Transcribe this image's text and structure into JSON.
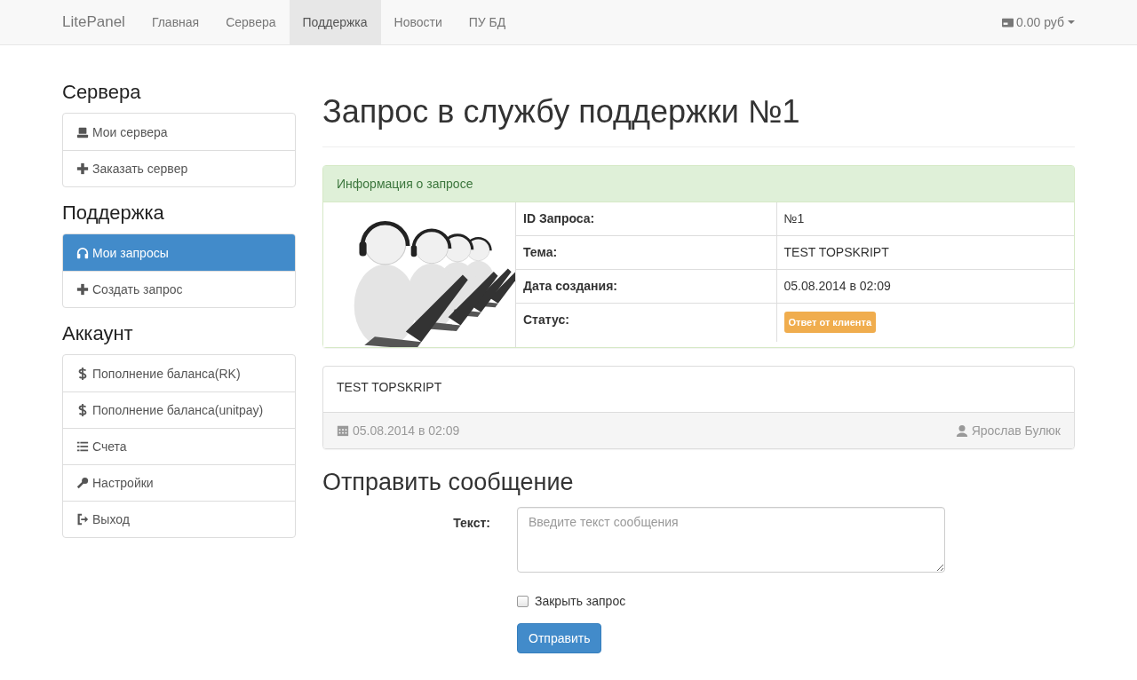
{
  "navbar": {
    "brand": "LitePanel",
    "items": [
      {
        "label": "Главная",
        "selected": false
      },
      {
        "label": "Сервера",
        "selected": false
      },
      {
        "label": "Поддержка",
        "selected": true
      },
      {
        "label": "Новости",
        "selected": false
      },
      {
        "label": "ПУ БД",
        "selected": false
      }
    ],
    "balance": "0.00 руб"
  },
  "sidebar": [
    {
      "heading": "Сервера",
      "items": [
        {
          "label": "Мои сервера",
          "kind": "server",
          "selected": false
        },
        {
          "label": "Заказать сервер",
          "kind": "plus",
          "selected": false
        }
      ]
    },
    {
      "heading": "Поддержка",
      "items": [
        {
          "label": "Мои запросы",
          "kind": "headphones",
          "selected": true
        },
        {
          "label": "Создать запрос",
          "kind": "plus",
          "selected": false
        }
      ]
    },
    {
      "heading": "Аккаунт",
      "items": [
        {
          "label": "Пополнение баланса(RK)",
          "kind": "dollar",
          "selected": false
        },
        {
          "label": "Пополнение баланса(unitpay)",
          "kind": "dollar",
          "selected": false
        },
        {
          "label": "Счета",
          "kind": "list",
          "selected": false
        },
        {
          "label": "Настройки",
          "kind": "wrench",
          "selected": false
        },
        {
          "label": "Выход",
          "kind": "logout",
          "selected": false
        }
      ]
    }
  ],
  "page_title": "Запрос в службу поддержки №1",
  "info_panel": {
    "heading": "Информация о запросе",
    "rows": [
      {
        "label": "ID Запроса:",
        "value": "№1"
      },
      {
        "label": "Тема:",
        "value": "TEST TOPSKRIPT"
      },
      {
        "label": "Дата создания:",
        "value": "05.08.2014 в 02:09"
      },
      {
        "label": "Статус:",
        "badge": "Ответ от клиента"
      }
    ]
  },
  "messages": [
    {
      "text": "TEST TOPSKRIPT",
      "date": "05.08.2014 в 02:09",
      "author": "Ярослав Булюк"
    }
  ],
  "reply_form": {
    "heading": "Отправить сообщение",
    "text_label": "Текст:",
    "text_placeholder": "Введите текст сообщения",
    "close_checkbox": {
      "label": "Закрыть запрос",
      "checked": false
    },
    "submit": "Отправить"
  }
}
